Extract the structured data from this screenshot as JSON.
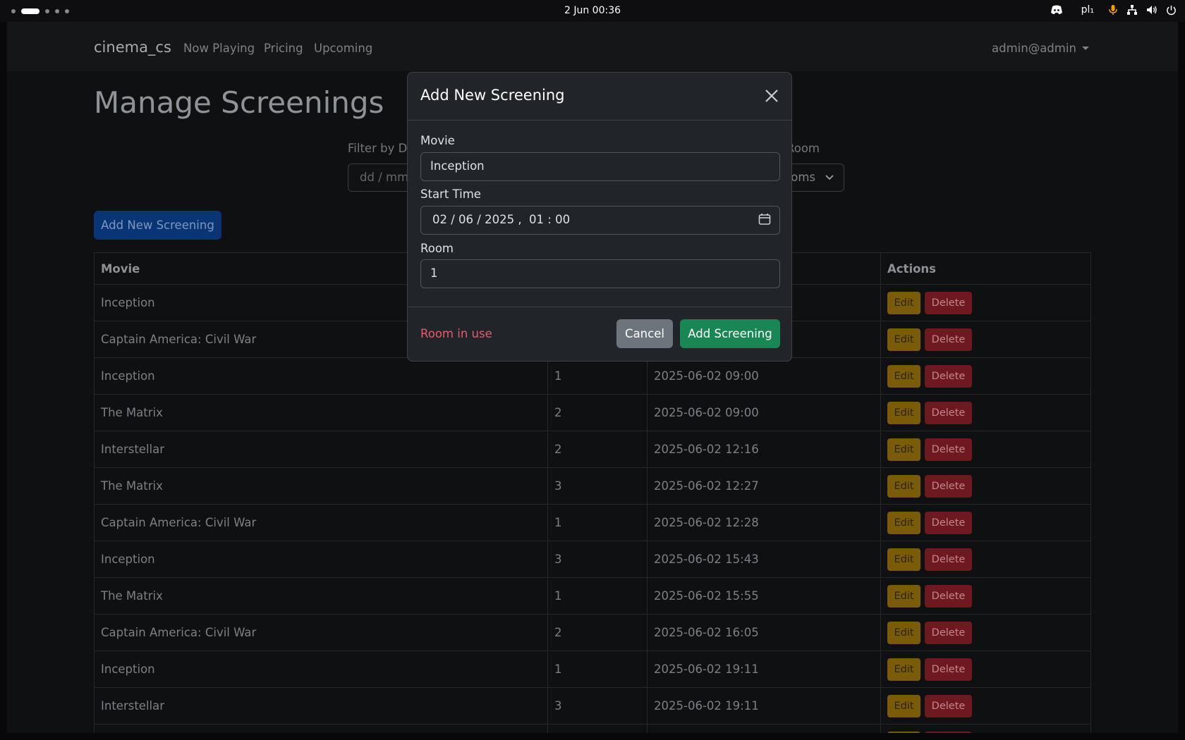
{
  "system_bar": {
    "clock": "2 Jun  00:36",
    "keyboard_layout": "pl₁"
  },
  "navbar": {
    "brand": "cinema_cs",
    "links": [
      "Now Playing",
      "Pricing",
      "Upcoming"
    ],
    "user": "admin@admin"
  },
  "page": {
    "title": "Manage Screenings",
    "filter_date_label": "Filter by D",
    "filter_date_placeholder": "dd / mm",
    "filter_room_label": "y Room",
    "filter_room_value": "oms",
    "add_button": "Add New Screening"
  },
  "table": {
    "headers": [
      "Movie",
      "",
      "",
      "Actions"
    ],
    "edit_label": "Edit",
    "delete_label": "Delete",
    "rows": [
      {
        "movie": "Inception",
        "room": "",
        "time": ""
      },
      {
        "movie": "Captain America: Civil War",
        "room": "",
        "time": ""
      },
      {
        "movie": "Inception",
        "room": "1",
        "time": "2025-06-02 09:00"
      },
      {
        "movie": "The Matrix",
        "room": "2",
        "time": "2025-06-02 09:00"
      },
      {
        "movie": "Interstellar",
        "room": "2",
        "time": "2025-06-02 12:16"
      },
      {
        "movie": "The Matrix",
        "room": "3",
        "time": "2025-06-02 12:27"
      },
      {
        "movie": "Captain America: Civil War",
        "room": "1",
        "time": "2025-06-02 12:28"
      },
      {
        "movie": "Inception",
        "room": "3",
        "time": "2025-06-02 15:43"
      },
      {
        "movie": "The Matrix",
        "room": "1",
        "time": "2025-06-02 15:55"
      },
      {
        "movie": "Captain America: Civil War",
        "room": "2",
        "time": "2025-06-02 16:05"
      },
      {
        "movie": "Inception",
        "room": "1",
        "time": "2025-06-02 19:11"
      },
      {
        "movie": "Interstellar",
        "room": "3",
        "time": "2025-06-02 19:11"
      },
      {
        "movie": "",
        "room": "",
        "time": ""
      }
    ]
  },
  "modal": {
    "title": "Add New Screening",
    "movie_label": "Movie",
    "movie_value": "Inception",
    "start_label": "Start Time",
    "start_value": "02 / 06 / 2025 ,  01 : 00",
    "room_label": "Room",
    "room_value": "1",
    "error": "Room in use",
    "cancel": "Cancel",
    "submit": "Add Screening"
  },
  "colors": {
    "primary": "#0d6efd",
    "success": "#198754",
    "warning": "#ffc107",
    "danger": "#dc3545",
    "secondary": "#6c757d",
    "error_text": "#e35d6a"
  }
}
